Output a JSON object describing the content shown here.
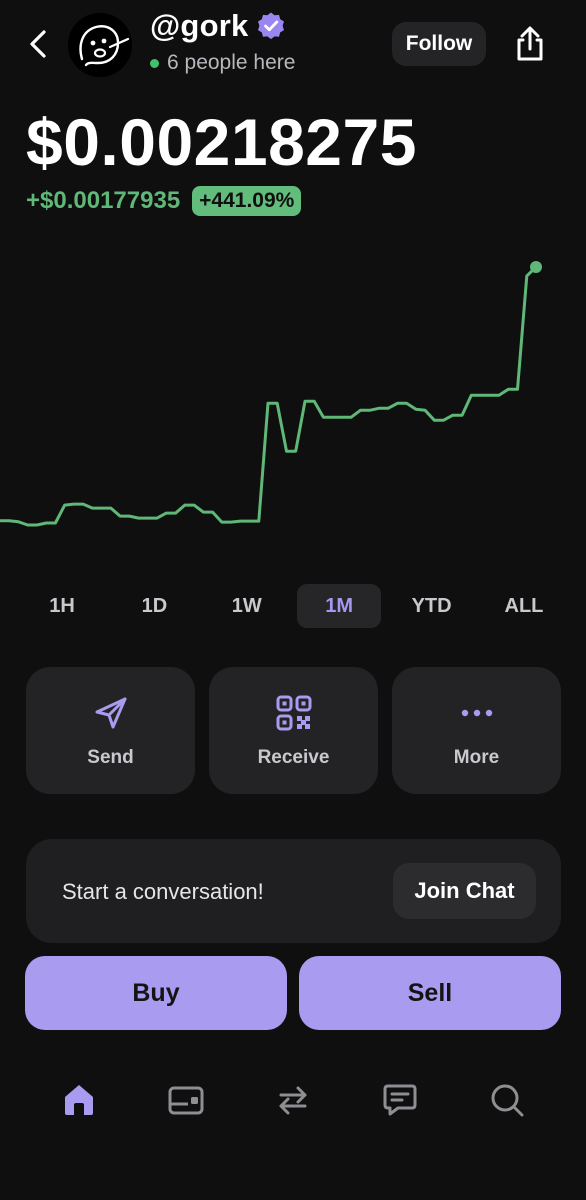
{
  "header": {
    "handle": "@gork",
    "presence": "6 people here",
    "follow_label": "Follow",
    "icons": [
      "back-chevron-icon",
      "verified-badge-icon",
      "share-icon"
    ],
    "avatar": "sketch-face-avatar"
  },
  "price": {
    "value": "$0.00218275",
    "change_abs": "+$0.00177935",
    "change_pct": "+441.09%"
  },
  "colors": {
    "background": "#0f0f10",
    "accent": "#a99bf0",
    "positive": "#5fb877",
    "card": "#232325"
  },
  "chart_data": {
    "type": "line",
    "x": [
      0,
      1,
      2,
      3,
      4,
      5,
      6,
      7,
      8,
      9,
      10,
      11,
      12,
      13,
      14,
      15,
      16,
      17,
      18,
      19,
      20,
      21,
      22,
      23,
      24,
      25,
      26,
      27,
      28,
      29,
      30,
      31,
      32,
      33,
      34,
      35,
      36,
      37,
      38,
      39,
      40,
      41,
      42,
      43,
      44,
      45,
      46,
      47,
      48,
      49,
      50,
      51,
      52,
      53,
      54,
      55,
      56,
      57,
      58,
      59,
      60,
      61,
      62,
      63,
      64,
      65,
      66,
      67,
      68,
      69,
      70,
      71,
      72,
      73,
      74,
      75,
      76,
      77,
      78,
      79,
      80,
      81,
      82,
      83,
      84,
      85,
      86,
      87,
      88,
      89,
      90,
      91,
      92,
      93,
      94,
      95,
      96,
      97,
      98,
      99,
      100
    ],
    "values": [
      0.000412,
      0.000412,
      0.000405,
      0.000383,
      0.000383,
      0.000397,
      0.000397,
      0.000522,
      0.000529,
      0.000529,
      0.000501,
      0.000501,
      0.000501,
      0.000445,
      0.000445,
      0.000431,
      0.000431,
      0.000431,
      0.000466,
      0.000466,
      0.000522,
      0.000522,
      0.000473,
      0.000473,
      0.000403,
      0.000403,
      0.00041,
      0.00041,
      0.00041,
      0.001232,
      0.001232,
      0.000898,
      0.000898,
      0.001246,
      0.001246,
      0.001135,
      0.001135,
      0.001135,
      0.001135,
      0.001183,
      0.001183,
      0.001197,
      0.001197,
      0.001232,
      0.001232,
      0.00119,
      0.001183,
      0.001114,
      0.001114,
      0.001149,
      0.001149,
      0.001288,
      0.001288,
      0.001288,
      0.001288,
      0.00133,
      0.00133,
      0.002121,
      0.002183
    ],
    "xlim": [
      0,
      1
    ],
    "ylim": [
      0,
      0.0023
    ],
    "grid": false,
    "legend": "none",
    "color": "#5fb877"
  },
  "ranges": [
    {
      "label": "1H",
      "active": false
    },
    {
      "label": "1D",
      "active": false
    },
    {
      "label": "1W",
      "active": false
    },
    {
      "label": "1M",
      "active": true
    },
    {
      "label": "YTD",
      "active": false
    },
    {
      "label": "ALL",
      "active": false
    }
  ],
  "actions": [
    {
      "label": "Send",
      "icon": "paper-plane-icon"
    },
    {
      "label": "Receive",
      "icon": "qr-code-icon"
    },
    {
      "label": "More",
      "icon": "more-dots-icon"
    }
  ],
  "conversation": {
    "text": "Start a conversation!",
    "join_label": "Join Chat"
  },
  "trade": {
    "buy_label": "Buy",
    "sell_label": "Sell"
  },
  "tabbar": {
    "icons": [
      "home-icon",
      "wallet-card-icon",
      "swap-arrows-icon",
      "chat-bubble-icon",
      "search-icon"
    ],
    "active": "home-icon"
  }
}
